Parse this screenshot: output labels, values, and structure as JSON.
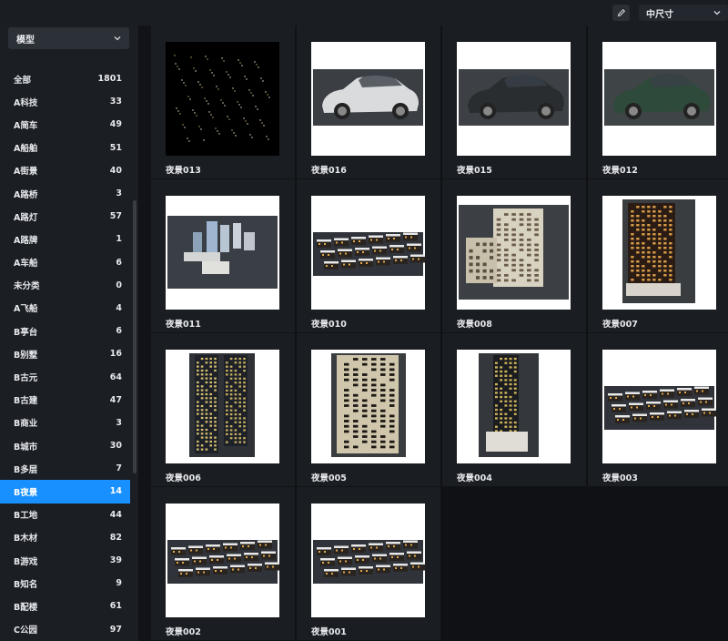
{
  "toolbar": {
    "size_select": "中尺寸"
  },
  "sidebar": {
    "model_select": "模型",
    "categories": [
      {
        "label": "全部",
        "count": "1801"
      },
      {
        "label": "A科技",
        "count": "33"
      },
      {
        "label": "A简车",
        "count": "49"
      },
      {
        "label": "A船舶",
        "count": "51"
      },
      {
        "label": "A街景",
        "count": "40"
      },
      {
        "label": "A路桥",
        "count": "3"
      },
      {
        "label": "A路灯",
        "count": "57"
      },
      {
        "label": "A路牌",
        "count": "1"
      },
      {
        "label": "A车船",
        "count": "6"
      },
      {
        "label": "未分类",
        "count": "0"
      },
      {
        "label": "A飞船",
        "count": "4"
      },
      {
        "label": "B亭台",
        "count": "6"
      },
      {
        "label": "B别墅",
        "count": "16"
      },
      {
        "label": "B古元",
        "count": "64"
      },
      {
        "label": "B古建",
        "count": "47"
      },
      {
        "label": "B商业",
        "count": "3"
      },
      {
        "label": "B城市",
        "count": "30"
      },
      {
        "label": "B多层",
        "count": "7"
      },
      {
        "label": "B夜景",
        "count": "14"
      },
      {
        "label": "B工地",
        "count": "44"
      },
      {
        "label": "B木材",
        "count": "82"
      },
      {
        "label": "B游戏",
        "count": "39"
      },
      {
        "label": "B知名",
        "count": "9"
      },
      {
        "label": "B配楼",
        "count": "61"
      },
      {
        "label": "C公园",
        "count": "97"
      }
    ],
    "active_index": 18
  },
  "assets": [
    {
      "name": "夜景013",
      "thumb": "night-stars"
    },
    {
      "name": "夜景016",
      "thumb": "white-sports-car"
    },
    {
      "name": "夜景015",
      "thumb": "dark-sedan"
    },
    {
      "name": "夜景012",
      "thumb": "green-sedan"
    },
    {
      "name": "夜景011",
      "thumb": "city-block"
    },
    {
      "name": "夜景010",
      "thumb": "row-houses"
    },
    {
      "name": "夜景008",
      "thumb": "apartment-building"
    },
    {
      "name": "夜景007",
      "thumb": "lit-tower"
    },
    {
      "name": "夜景006",
      "thumb": "twin-towers"
    },
    {
      "name": "夜景005",
      "thumb": "office-block"
    },
    {
      "name": "夜景004",
      "thumb": "tower-on-podium"
    },
    {
      "name": "夜景003",
      "thumb": "housing-estate"
    },
    {
      "name": "夜景002",
      "thumb": "residential-cluster"
    },
    {
      "name": "夜景001",
      "thumb": "residential-cluster-2"
    }
  ],
  "colors": {
    "accent": "#1890ff",
    "background": "#111318",
    "panel": "#1b1e23"
  }
}
